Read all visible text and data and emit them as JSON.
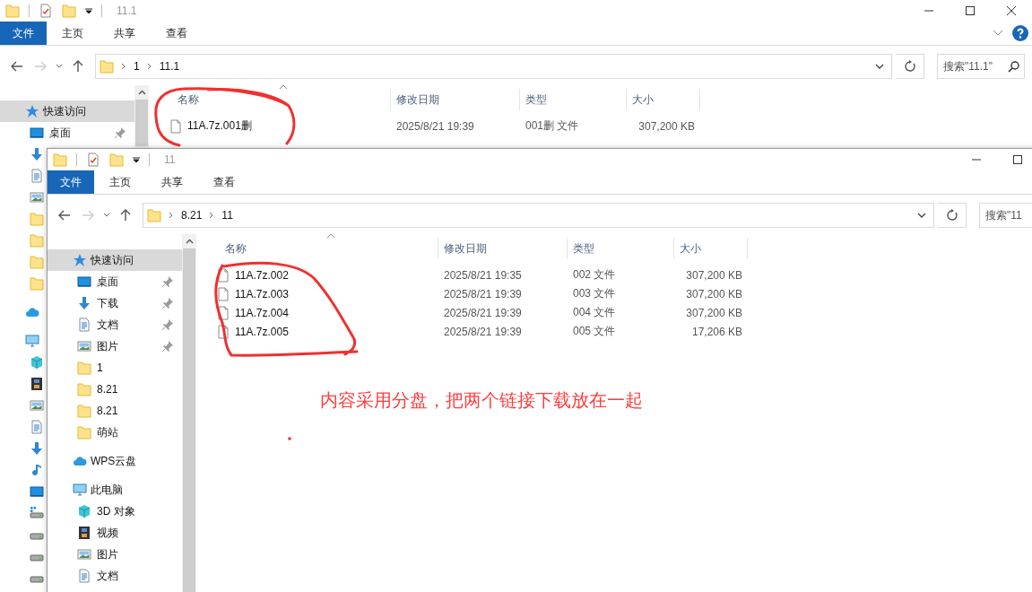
{
  "windows": [
    {
      "title": "11.1",
      "ribbon_tabs": [
        {
          "label": "文件",
          "selected": true
        },
        {
          "label": "主页",
          "selected": false
        },
        {
          "label": "共享",
          "selected": false
        },
        {
          "label": "查看",
          "selected": false
        }
      ],
      "address": {
        "path": [
          "1",
          "11.1"
        ]
      },
      "search": {
        "placeholder": "搜索\"11.1\""
      },
      "sidebar": [
        {
          "kind": "star",
          "label": "快速访问",
          "selected": true,
          "children": [
            {
              "kind": "desktop",
              "label": "桌面",
              "selected": false,
              "pinned": true
            },
            {
              "kind": "download",
              "selected": false,
              "pinned": false
            },
            {
              "kind": "doc",
              "selected": false,
              "pinned": false
            },
            {
              "kind": "picture",
              "selected": false,
              "pinned": false
            },
            {
              "kind": "folder",
              "selected": false,
              "pinned": false
            },
            {
              "kind": "folder",
              "selected": false,
              "pinned": false
            },
            {
              "kind": "folder",
              "selected": false,
              "pinned": false
            },
            {
              "kind": "folder",
              "selected": false,
              "pinned": false
            }
          ]
        },
        {
          "kind": "cloud",
          "selected": false
        },
        {
          "kind": "pc",
          "selected": false,
          "children": [
            {
              "kind": "cube",
              "selected": false,
              "pinned": false
            },
            {
              "kind": "video",
              "selected": false,
              "pinned": false
            },
            {
              "kind": "picture",
              "selected": false,
              "pinned": false
            },
            {
              "kind": "doc",
              "selected": false,
              "pinned": false
            },
            {
              "kind": "download",
              "selected": false,
              "pinned": false
            },
            {
              "kind": "music",
              "selected": false,
              "pinned": false
            },
            {
              "kind": "desktop",
              "selected": false,
              "pinned": false
            },
            {
              "kind": "drive-win",
              "selected": false,
              "pinned": false
            },
            {
              "kind": "drive",
              "selected": false,
              "pinned": false
            },
            {
              "kind": "drive",
              "selected": false,
              "pinned": false
            },
            {
              "kind": "drive",
              "selected": false,
              "pinned": false
            }
          ]
        }
      ],
      "columns": [
        "名称",
        "修改日期",
        "类型",
        "大小"
      ],
      "rows": [
        {
          "name": "11A.7z.001删",
          "date": "2025/8/21 19:39",
          "type": "001删 文件",
          "size": "307,200 KB"
        }
      ]
    },
    {
      "title": "11",
      "ribbon_tabs": [
        {
          "label": "文件",
          "selected": true
        },
        {
          "label": "主页",
          "selected": false
        },
        {
          "label": "共享",
          "selected": false
        },
        {
          "label": "查看",
          "selected": false
        }
      ],
      "address": {
        "path": [
          "8.21",
          "11"
        ]
      },
      "search": {
        "placeholder": "搜索\"11"
      },
      "sidebar": [
        {
          "kind": "star",
          "label": "快速访问",
          "selected": true,
          "children": [
            {
              "kind": "desktop",
              "label": "桌面",
              "selected": false,
              "pinned": true
            },
            {
              "kind": "download",
              "label": "下载",
              "selected": false,
              "pinned": true
            },
            {
              "kind": "doc",
              "label": "文档",
              "selected": false,
              "pinned": true
            },
            {
              "kind": "picture",
              "label": "图片",
              "selected": false,
              "pinned": true
            },
            {
              "kind": "folder",
              "label": "1",
              "selected": false,
              "pinned": false
            },
            {
              "kind": "folder",
              "label": "8.21",
              "selected": false,
              "pinned": false
            },
            {
              "kind": "folder",
              "label": "8.21",
              "selected": false,
              "pinned": false
            },
            {
              "kind": "folder",
              "label": "萌站",
              "selected": false,
              "pinned": false
            }
          ]
        },
        {
          "kind": "cloud",
          "label": "WPS云盘",
          "selected": false
        },
        {
          "kind": "pc",
          "label": "此电脑",
          "selected": false,
          "children": [
            {
              "kind": "cube",
              "label": "3D 对象",
              "selected": false,
              "pinned": false
            },
            {
              "kind": "video",
              "label": "视频",
              "selected": false,
              "pinned": false
            },
            {
              "kind": "picture",
              "label": "图片",
              "selected": false,
              "pinned": false
            },
            {
              "kind": "doc",
              "label": "文档",
              "selected": false,
              "pinned": false
            }
          ]
        }
      ],
      "columns": [
        "名称",
        "修改日期",
        "类型",
        "大小"
      ],
      "rows": [
        {
          "name": "11A.7z.002",
          "date": "2025/8/21 19:35",
          "type": "002 文件",
          "size": "307,200 KB"
        },
        {
          "name": "11A.7z.003",
          "date": "2025/8/21 19:39",
          "type": "003 文件",
          "size": "307,200 KB"
        },
        {
          "name": "11A.7z.004",
          "date": "2025/8/21 19:39",
          "type": "004 文件",
          "size": "307,200 KB"
        },
        {
          "name": "11A.7z.005",
          "date": "2025/8/21 19:39",
          "type": "005 文件",
          "size": "17,206 KB"
        }
      ]
    }
  ],
  "annotation": {
    "note": "内容采用分盘，把两个链接下载放在一起"
  }
}
